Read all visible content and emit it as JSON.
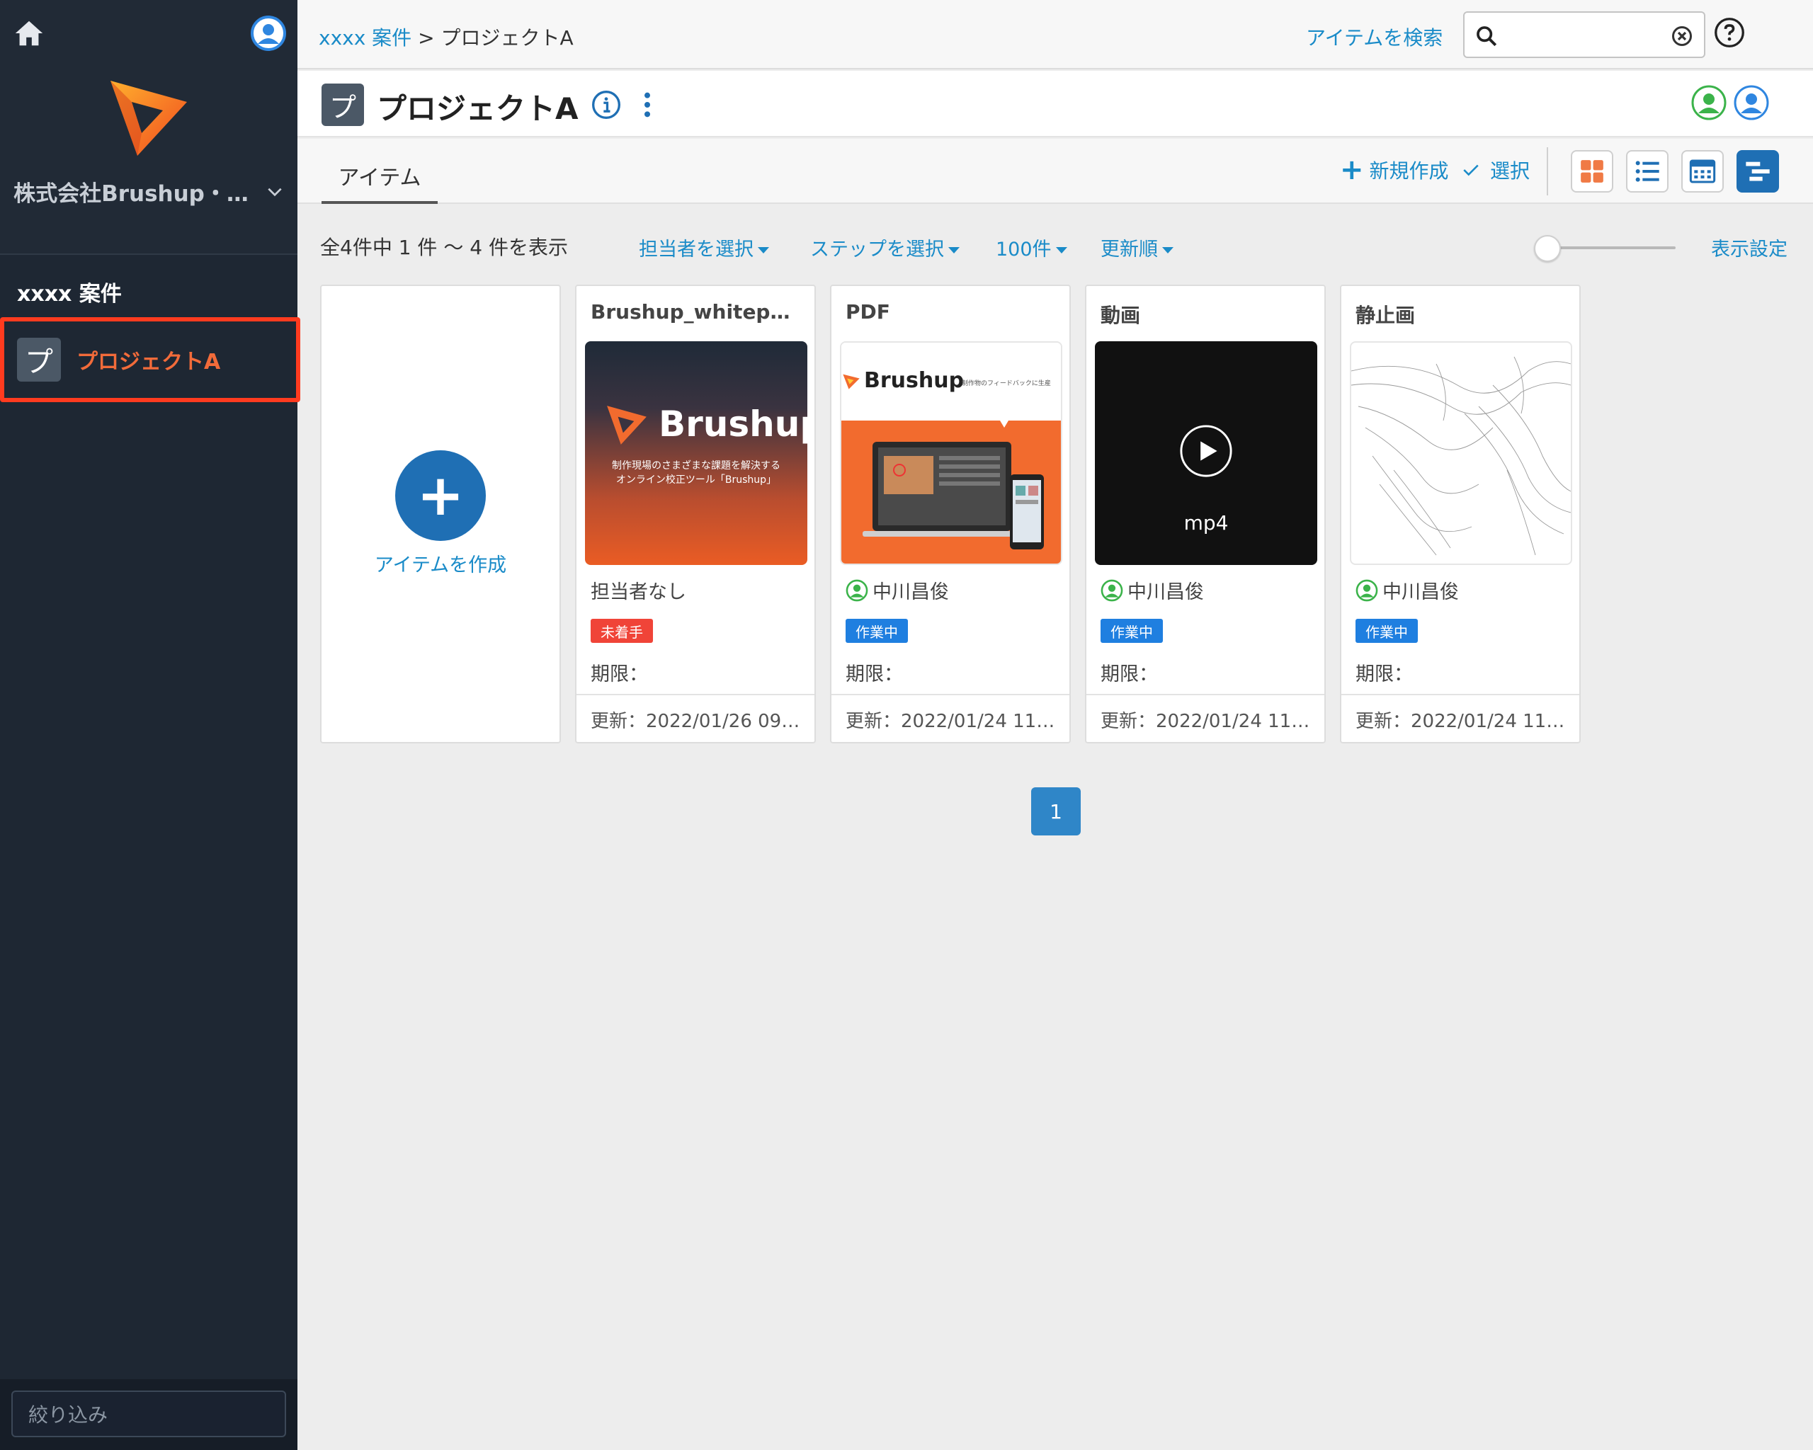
{
  "sidebar": {
    "company": "株式会社Brushup・…",
    "section_title": "xxxx 案件",
    "project_icon_char": "プ",
    "project_label": "プロジェクトA",
    "filter_placeholder": "絞り込み"
  },
  "header": {
    "breadcrumb_link": "xxxx 案件",
    "breadcrumb_sep": ">",
    "breadcrumb_current": "プロジェクトA",
    "search_label": "アイテムを検索",
    "search_value": ""
  },
  "project": {
    "icon_char": "プ",
    "title": "プロジェクトA"
  },
  "tabs": [
    {
      "label": "アイテム",
      "active": true
    }
  ],
  "toolbar": {
    "new_label": "新規作成",
    "select_label": "選択"
  },
  "filters": {
    "count_text": "全4件中 1 件 〜 4 件を表示",
    "assignee": "担当者を選択",
    "step": "ステップを選択",
    "per_page": "100件",
    "sort": "更新順",
    "display_settings": "表示設定"
  },
  "create_card": {
    "label": "アイテムを作成"
  },
  "cards": [
    {
      "title": "Brushup_whitepap…",
      "assignee": "担当者なし",
      "has_avatar": false,
      "status": "未着手",
      "status_color": "#f04438",
      "deadline": "期限：",
      "updated": "更新：2022/01/26 09:…",
      "thumb": {
        "brand": "Brushup",
        "line1": "制作現場のさまざまな課題を解決する",
        "line2": "オンライン校正ツール「Brushup」"
      }
    },
    {
      "title": "PDF",
      "assignee": "中川昌俊",
      "has_avatar": true,
      "status": "作業中",
      "status_color": "#1f7fe0",
      "deadline": "期限：",
      "updated": "更新：2022/01/24 11:…",
      "thumb": {
        "brand": "Brushup",
        "tagline": "制作物のフィードバックに生産"
      }
    },
    {
      "title": "動画",
      "assignee": "中川昌俊",
      "has_avatar": true,
      "status": "作業中",
      "status_color": "#1f7fe0",
      "deadline": "期限：",
      "updated": "更新：2022/01/24 11:…",
      "thumb": {
        "format": "mp4"
      }
    },
    {
      "title": "静止画",
      "assignee": "中川昌俊",
      "has_avatar": true,
      "status": "作業中",
      "status_color": "#1f7fe0",
      "deadline": "期限：",
      "updated": "更新：2022/01/24 11:…"
    }
  ],
  "pagination": {
    "current": "1"
  },
  "colors": {
    "accent": "#1a8bc8",
    "brand_orange": "#f26b3a",
    "sidebar_bg": "#1e2733",
    "highlight_frame": "#ff3b1f"
  },
  "icons": {
    "home": "home-icon",
    "user": "user-avatar-icon",
    "search": "search-icon",
    "clear": "clear-icon",
    "help": "help-icon",
    "info": "info-icon",
    "more": "more-vertical-icon",
    "views": [
      "grid-view-icon",
      "list-view-icon",
      "calendar-view-icon",
      "gantt-view-icon"
    ]
  }
}
